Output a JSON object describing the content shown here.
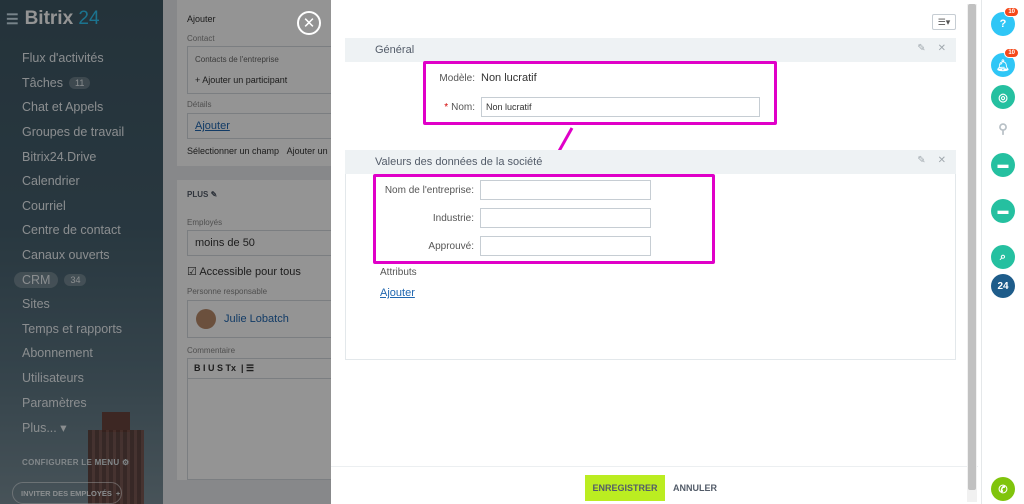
{
  "nav": {
    "logo_text": "Bitrix",
    "logo_num": "24",
    "items": [
      {
        "label": "Flux d'activités",
        "badge": ""
      },
      {
        "label": "Tâches",
        "badge": "11"
      },
      {
        "label": "Chat et Appels",
        "badge": ""
      },
      {
        "label": "Groupes de travail",
        "badge": ""
      },
      {
        "label": "Bitrix24.Drive",
        "badge": ""
      },
      {
        "label": "Calendrier",
        "badge": ""
      },
      {
        "label": "Courriel",
        "badge": ""
      },
      {
        "label": "Centre de contact",
        "badge": ""
      },
      {
        "label": "Canaux ouverts",
        "badge": ""
      },
      {
        "label": "CRM",
        "badge": "34"
      },
      {
        "label": "Sites",
        "badge": ""
      },
      {
        "label": "Temps et rapports",
        "badge": ""
      },
      {
        "label": "Abonnement",
        "badge": ""
      },
      {
        "label": "Utilisateurs",
        "badge": ""
      },
      {
        "label": "Paramètres",
        "badge": ""
      },
      {
        "label": "Plus... ▾",
        "badge": ""
      }
    ],
    "configure": "CONFIGURER LE MENU",
    "invite": "INVITER DES EMPLOYÉS"
  },
  "background_form": {
    "add": "Ajouter",
    "contact_label": "Contact",
    "company_contacts": "Contacts de l'entreprise",
    "add_participant": "+ Ajouter un participant",
    "details_label": "Détails",
    "details_link": "Ajouter",
    "select_field": "Sélectionner un champ",
    "add_short": "Ajouter un",
    "plus_title": "PLUS",
    "employees_label": "Employés",
    "employees_value": "moins de 50",
    "accessible": "Accessible pour tous",
    "responsible_label": "Personne responsable",
    "responsible_name": "Julie Lobatch",
    "comment_label": "Commentaire",
    "toolbar": "B  I  U  S  Tx"
  },
  "panel": {
    "section1_title": "Général",
    "model_label": "Modèle:",
    "model_value": "Non lucratif",
    "name_required": "*",
    "name_label": "Nom:",
    "name_value": "Non lucratif",
    "section2_title": "Valeurs des données de la société",
    "company_name_label": "Nom de l'entreprise:",
    "industry_label": "Industrie:",
    "approved_label": "Approuvé:",
    "attributes_label": "Attributs",
    "add_link": "Ajouter",
    "save_button": "ENREGISTRER",
    "cancel_button": "ANNULER"
  },
  "right_bar": {
    "help_count": "10",
    "notif_count": "10",
    "label_24": "24"
  },
  "colors": {
    "highlight": "#e000c8",
    "save_green": "#bbed21",
    "link_blue": "#2067b0"
  }
}
